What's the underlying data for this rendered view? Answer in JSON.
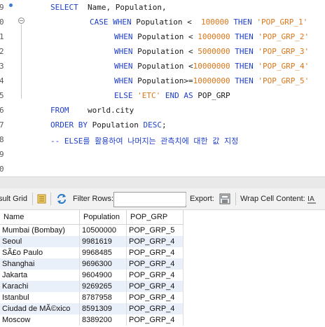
{
  "editor": {
    "line_numbers": [
      "9",
      "0",
      "1",
      "2",
      "3",
      "4",
      "5",
      "6",
      "7",
      "8",
      "9",
      "0"
    ],
    "lines": [
      [
        {
          "t": "SELECT  ",
          "c": "kw"
        },
        {
          "t": "Name, Population,",
          "c": "tx"
        }
      ],
      [
        {
          "t": "CASE WHEN ",
          "c": "kw"
        },
        {
          "t": "Population <  ",
          "c": "tx"
        },
        {
          "t": "100000 ",
          "c": "num"
        },
        {
          "t": "THEN ",
          "c": "kw"
        },
        {
          "t": "'POP_GRP_1'",
          "c": "str"
        }
      ],
      [
        {
          "t": "WHEN ",
          "c": "kw"
        },
        {
          "t": "Population < ",
          "c": "tx"
        },
        {
          "t": "1000000 ",
          "c": "num"
        },
        {
          "t": "THEN ",
          "c": "kw"
        },
        {
          "t": "'POP_GRP_2'",
          "c": "str"
        }
      ],
      [
        {
          "t": "WHEN ",
          "c": "kw"
        },
        {
          "t": "Population < ",
          "c": "tx"
        },
        {
          "t": "5000000 ",
          "c": "num"
        },
        {
          "t": "THEN ",
          "c": "kw"
        },
        {
          "t": "'POP_GRP_3'",
          "c": "str"
        }
      ],
      [
        {
          "t": "WHEN ",
          "c": "kw"
        },
        {
          "t": "Population <",
          "c": "tx"
        },
        {
          "t": "10000000 ",
          "c": "num"
        },
        {
          "t": "THEN ",
          "c": "kw"
        },
        {
          "t": "'POP_GRP_4'",
          "c": "str"
        }
      ],
      [
        {
          "t": "WHEN ",
          "c": "kw"
        },
        {
          "t": "Population>=",
          "c": "tx"
        },
        {
          "t": "10000000 ",
          "c": "num"
        },
        {
          "t": "THEN ",
          "c": "kw"
        },
        {
          "t": "'POP_GRP_5'",
          "c": "str"
        }
      ],
      [
        {
          "t": "ELSE ",
          "c": "kw"
        },
        {
          "t": "'ETC' ",
          "c": "str"
        },
        {
          "t": "END AS ",
          "c": "kw"
        },
        {
          "t": "POP_GRP",
          "c": "tx"
        }
      ],
      [
        {
          "t": "FROM    ",
          "c": "kw"
        },
        {
          "t": "world.city",
          "c": "tx"
        }
      ],
      [
        {
          "t": "ORDER BY ",
          "c": "kw"
        },
        {
          "t": "Population ",
          "c": "tx"
        },
        {
          "t": "DESC",
          "c": "kw"
        },
        {
          "t": ";",
          "c": "tx"
        }
      ],
      [
        {
          "t": "-- ELSE를 활용하여 나머지는 관측치에 대한 값 지정",
          "c": "cm"
        }
      ],
      [],
      []
    ]
  },
  "toolbar": {
    "result_grid_label": "sult Grid",
    "filter_rows_label": "Filter Rows:",
    "filter_rows_value": "",
    "export_label": "Export:",
    "wrap_label": "Wrap Cell Content:"
  },
  "grid": {
    "columns": [
      "Name",
      "Population",
      "POP_GRP"
    ],
    "rows": [
      [
        "Mumbai (Bombay)",
        "10500000",
        "POP_GRP_5"
      ],
      [
        "Seoul",
        "9981619",
        "POP_GRP_4"
      ],
      [
        "SÃ£o Paulo",
        "9968485",
        "POP_GRP_4"
      ],
      [
        "Shanghai",
        "9696300",
        "POP_GRP_4"
      ],
      [
        "Jakarta",
        "9604900",
        "POP_GRP_4"
      ],
      [
        "Karachi",
        "9269265",
        "POP_GRP_4"
      ],
      [
        "Istanbul",
        "8787958",
        "POP_GRP_4"
      ],
      [
        "Ciudad de MÃ©xico",
        "8591309",
        "POP_GRP_4"
      ],
      [
        "Moscow",
        "8389200",
        "POP_GRP_4"
      ]
    ]
  },
  "colors": {
    "keyword": "#1f3fc8",
    "string": "#d9761a",
    "row_alt": "#eaf0fa"
  }
}
